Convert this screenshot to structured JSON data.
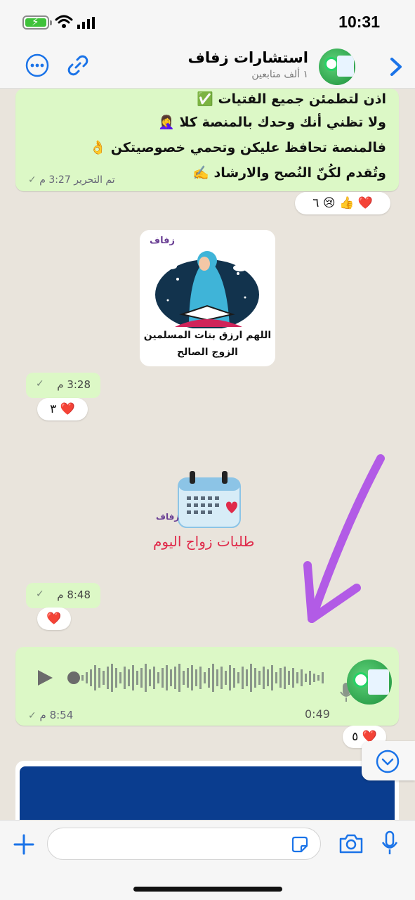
{
  "status_bar": {
    "time": "10:31"
  },
  "header": {
    "channel_name": "استشارات زفاف",
    "followers": "١ ألف متابعين"
  },
  "text_message": {
    "lines": [
      "اذن لتطمئن جميع الفتيات ✅",
      "ولا تظني أنك وحدك بالمنصة كلا 🤦‍♀️",
      "فالمنصة تحافظ عليكن وتحمي خصوصيتكن 👌",
      "وتُقدم لكُنّ النُصح والارشاد ✍️"
    ],
    "meta": "تم التحرير 3:27 م",
    "reactions": "❤️ 👍 😢 ٦"
  },
  "image_message": {
    "logo_text": "زفاف",
    "caption_line1": "اللهم ارزق بنات المسلمين",
    "caption_line2": "الزوج الصالح",
    "time": "3:28 م",
    "reactions": "❤️ ٣"
  },
  "sticker_message": {
    "logo_text": "زفاف",
    "title": "طلبات زواج اليوم",
    "time": "8:48 م",
    "reactions": "❤️"
  },
  "voice_message": {
    "duration": "0:49",
    "time": "8:54 م",
    "reactions": "❤️ ٥"
  },
  "colors": {
    "bubble": "#dcf8c6",
    "accent": "#1a73e8",
    "annotation_arrow": "#b25be6",
    "heart": "#e02a4a"
  }
}
